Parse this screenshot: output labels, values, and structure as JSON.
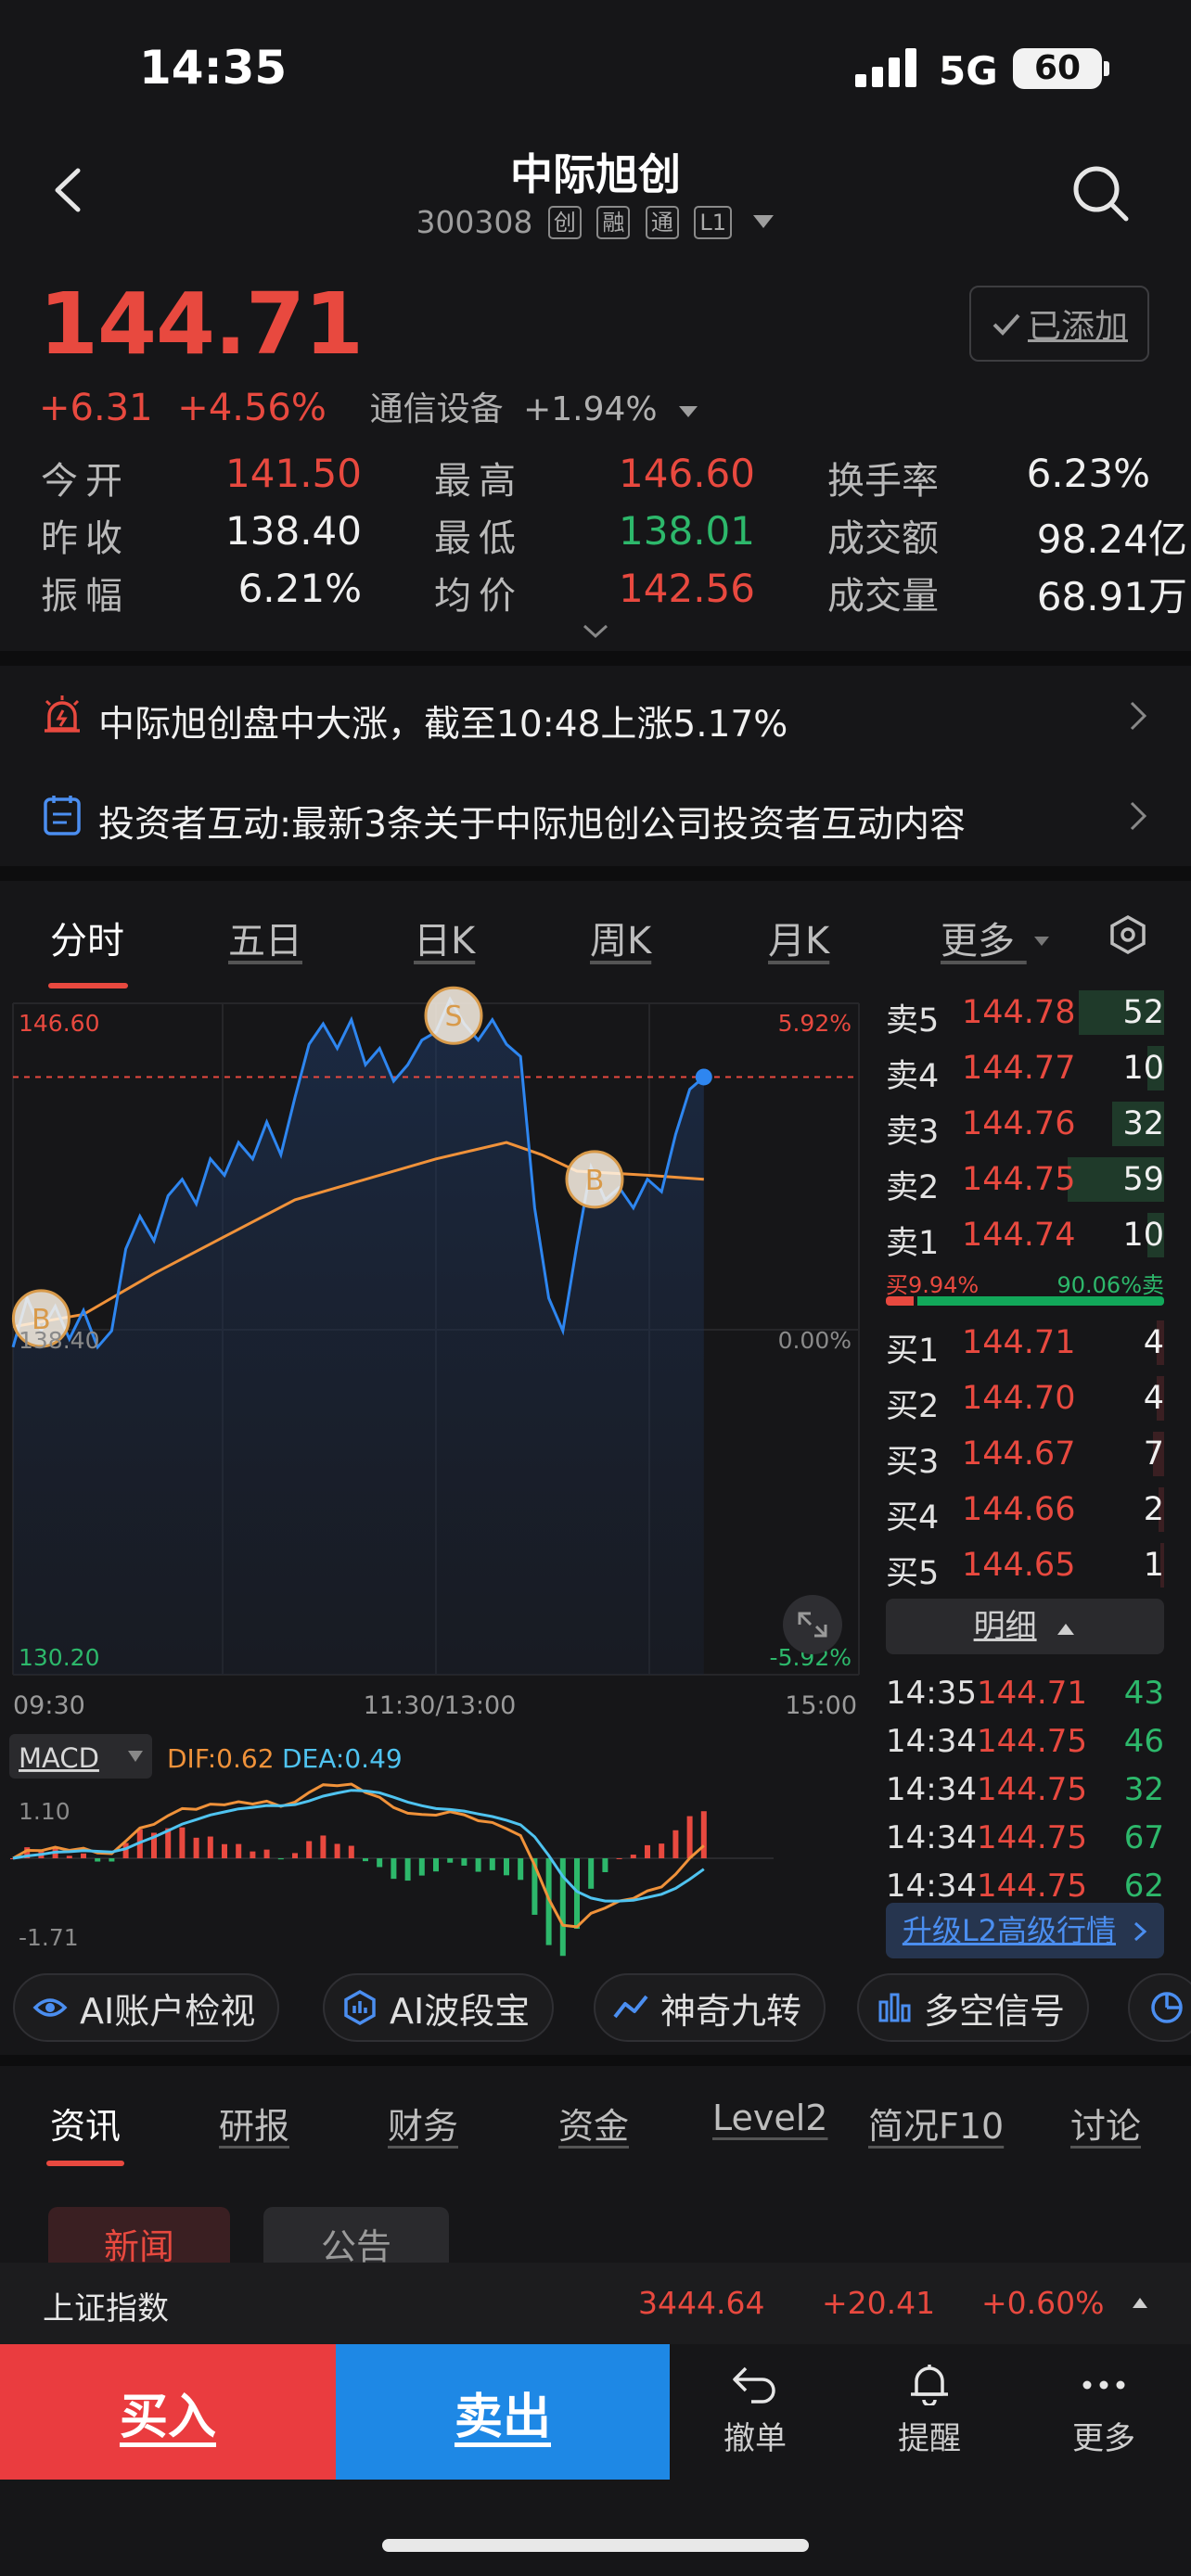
{
  "status_bar": {
    "time": "14:35",
    "network": "5G",
    "battery": "60"
  },
  "header": {
    "name": "中际旭创",
    "code": "300308",
    "tags": [
      "创",
      "融",
      "通",
      "L1"
    ]
  },
  "quote": {
    "price": "144.71",
    "change": "+6.31",
    "change_pct": "+4.56%",
    "sector": "通信设备",
    "sector_pct": "+1.94%",
    "added_label": "已添加",
    "fields": [
      {
        "label": "今开",
        "value": "141.50",
        "color": "red"
      },
      {
        "label": "最高",
        "value": "146.60",
        "color": "red"
      },
      {
        "label": "换手率",
        "value": "6.23%",
        "color": "white"
      },
      {
        "label": "昨收",
        "value": "138.40",
        "color": "white"
      },
      {
        "label": "最低",
        "value": "138.01",
        "color": "green"
      },
      {
        "label": "成交额",
        "value": "98.24亿",
        "color": "white"
      },
      {
        "label": "振幅",
        "value": "6.21%",
        "color": "white"
      },
      {
        "label": "均价",
        "value": "142.56",
        "color": "red"
      },
      {
        "label": "成交量",
        "value": "68.91万",
        "color": "white"
      }
    ]
  },
  "news": [
    {
      "text": "中际旭创盘中大涨，截至10:48上涨5.17%",
      "icon": "alarm-icon"
    },
    {
      "text": "投资者互动:最新3条关于中际旭创公司投资者互动内容",
      "icon": "notepad-icon"
    }
  ],
  "chart_tabs": [
    "分时",
    "五日",
    "日K",
    "周K",
    "月K",
    "更多"
  ],
  "chart": {
    "y_top_left": "146.60",
    "y_mid_left": "138.40",
    "y_bot_left": "130.20",
    "y_top_right": "5.92%",
    "y_mid_right": "0.00%",
    "y_bot_right": "-5.92%",
    "x_labels": [
      "09:30",
      "11:30/13:00",
      "15:00"
    ],
    "markers": [
      {
        "label": "B",
        "price": 138.9,
        "minute": 8
      },
      {
        "label": "S",
        "price": 146.3,
        "minute": 125
      },
      {
        "label": "B",
        "price": 142.3,
        "minute": 165
      }
    ],
    "macd": {
      "label": "MACD",
      "dif": "DIF:0.62",
      "dea": "DEA:0.49",
      "top": "1.10",
      "bottom": "-1.71"
    }
  },
  "chart_data": {
    "type": "line",
    "title": "",
    "y_range": [
      130.2,
      146.6
    ],
    "pre_close": 138.4,
    "x_range": [
      0,
      240
    ],
    "series": [
      {
        "values": [
          [
            0,
            138.2
          ],
          [
            4,
            139.4
          ],
          [
            8,
            138.6
          ],
          [
            12,
            139.2
          ],
          [
            16,
            138.4
          ],
          [
            20,
            139.1
          ],
          [
            24,
            138.2
          ],
          [
            28,
            138.6
          ],
          [
            32,
            140.6
          ],
          [
            36,
            141.4
          ],
          [
            40,
            140.8
          ],
          [
            44,
            141.9
          ],
          [
            48,
            142.3
          ],
          [
            52,
            141.7
          ],
          [
            56,
            142.8
          ],
          [
            60,
            142.4
          ],
          [
            64,
            143.2
          ],
          [
            68,
            142.8
          ],
          [
            72,
            143.7
          ],
          [
            76,
            142.9
          ],
          [
            80,
            144.3
          ],
          [
            84,
            145.6
          ],
          [
            88,
            146.1
          ],
          [
            92,
            145.5
          ],
          [
            96,
            146.2
          ],
          [
            100,
            145.1
          ],
          [
            104,
            145.5
          ],
          [
            108,
            144.7
          ],
          [
            112,
            145.1
          ],
          [
            116,
            145.7
          ],
          [
            120,
            145.9
          ],
          [
            124,
            146.7
          ],
          [
            128,
            146.1
          ],
          [
            132,
            145.7
          ],
          [
            136,
            146.2
          ],
          [
            140,
            145.6
          ],
          [
            144,
            145.3
          ],
          [
            148,
            141.6
          ],
          [
            152,
            139.4
          ],
          [
            156,
            138.6
          ],
          [
            160,
            140.7
          ],
          [
            164,
            142.6
          ],
          [
            168,
            141.8
          ],
          [
            172,
            142.1
          ],
          [
            176,
            141.6
          ],
          [
            180,
            142.3
          ],
          [
            184,
            142.0
          ],
          [
            188,
            143.4
          ],
          [
            192,
            144.5
          ],
          [
            196,
            144.8
          ]
        ]
      },
      {
        "values": [
          [
            0,
            138.7
          ],
          [
            20,
            139.0
          ],
          [
            40,
            140.0
          ],
          [
            60,
            140.9
          ],
          [
            80,
            141.8
          ],
          [
            100,
            142.3
          ],
          [
            120,
            142.8
          ],
          [
            140,
            143.2
          ],
          [
            150,
            142.9
          ],
          [
            160,
            142.5
          ],
          [
            180,
            142.4
          ],
          [
            196,
            142.3
          ]
        ]
      }
    ]
  },
  "order_book": {
    "asks": [
      {
        "label": "卖5",
        "price": "144.78",
        "vol": "52"
      },
      {
        "label": "卖4",
        "price": "144.77",
        "vol": "10"
      },
      {
        "label": "卖3",
        "price": "144.76",
        "vol": "32"
      },
      {
        "label": "卖2",
        "price": "144.75",
        "vol": "59"
      },
      {
        "label": "卖1",
        "price": "144.74",
        "vol": "10"
      }
    ],
    "buy_ratio": "买9.94%",
    "sell_ratio": "90.06%卖",
    "bids": [
      {
        "label": "买1",
        "price": "144.71",
        "vol": "4"
      },
      {
        "label": "买2",
        "price": "144.70",
        "vol": "4"
      },
      {
        "label": "买3",
        "price": "144.67",
        "vol": "7"
      },
      {
        "label": "买4",
        "price": "144.66",
        "vol": "2"
      },
      {
        "label": "买5",
        "price": "144.65",
        "vol": "1"
      }
    ],
    "detail_label": "明细",
    "ticks": [
      {
        "time": "14:35",
        "price": "144.71",
        "vol": "43"
      },
      {
        "time": "14:34",
        "price": "144.75",
        "vol": "46"
      },
      {
        "time": "14:34",
        "price": "144.75",
        "vol": "32"
      },
      {
        "time": "14:34",
        "price": "144.75",
        "vol": "67"
      },
      {
        "time": "14:34",
        "price": "144.75",
        "vol": "62"
      }
    ],
    "upgrade_label": "升级L2高级行情"
  },
  "tools": [
    "AI账户检视",
    "AI波段宝",
    "神奇九转",
    "多空信号"
  ],
  "info_tabs": [
    "资讯",
    "研报",
    "财务",
    "资金",
    "Level2",
    "简况F10",
    "讨论"
  ],
  "sub_tabs": [
    "新闻",
    "公告"
  ],
  "index_bar": {
    "name": "上证指数",
    "value": "3444.64",
    "change": "+20.41",
    "pct": "+0.60%"
  },
  "actions": {
    "buy": "买入",
    "sell": "卖出",
    "cancel": "撤单",
    "alert": "提醒",
    "more": "更多"
  }
}
